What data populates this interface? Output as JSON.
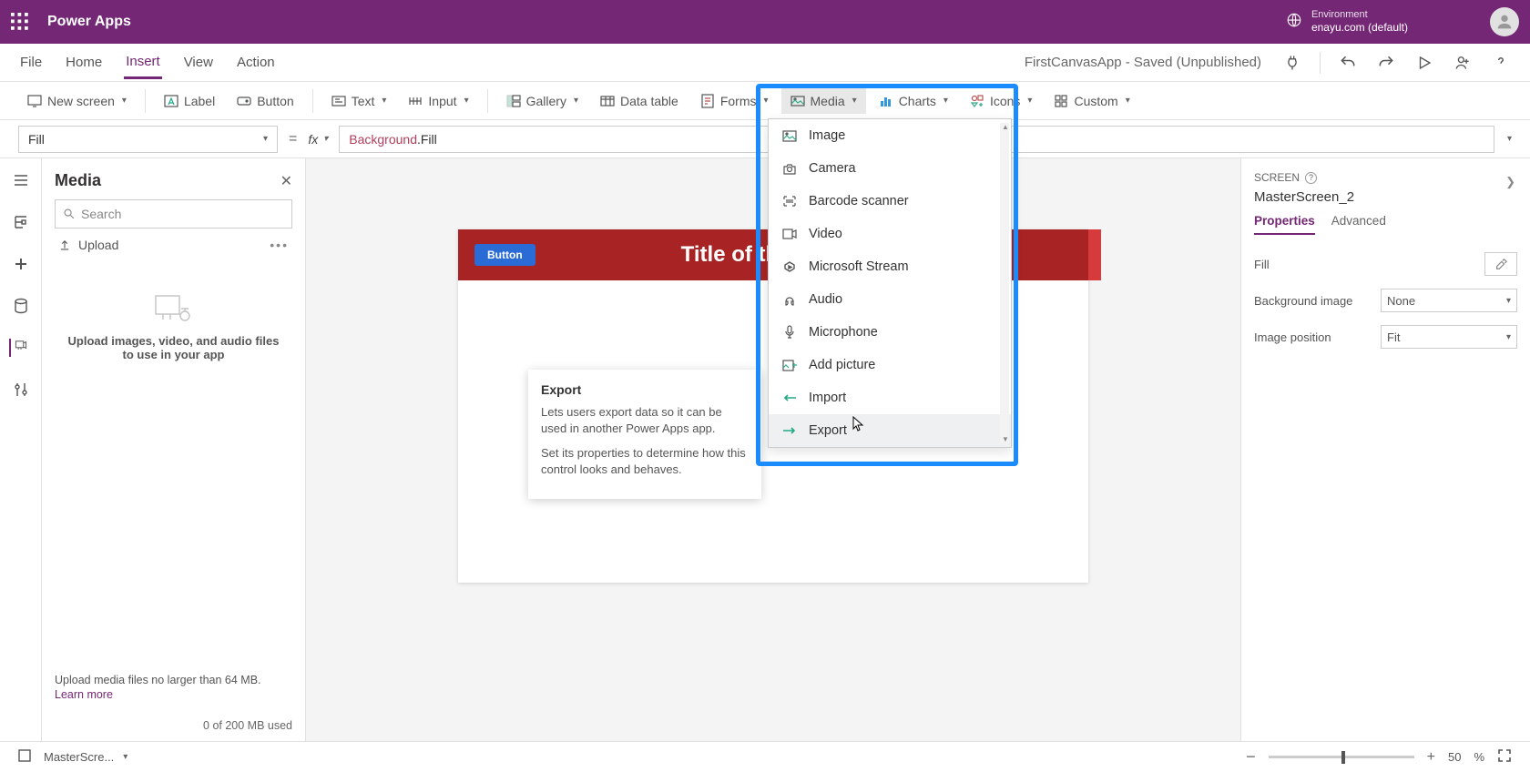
{
  "header": {
    "app_name": "Power Apps",
    "env_label": "Environment",
    "env_name": "enayu.com (default)"
  },
  "menu": {
    "tabs": [
      "File",
      "Home",
      "Insert",
      "View",
      "Action"
    ],
    "active": "Insert",
    "file_status": "FirstCanvasApp - Saved (Unpublished)"
  },
  "ribbon": {
    "new_screen": "New screen",
    "label": "Label",
    "button": "Button",
    "text": "Text",
    "input": "Input",
    "gallery": "Gallery",
    "data_table": "Data table",
    "forms": "Forms",
    "media": "Media",
    "charts": "Charts",
    "icons": "Icons",
    "custom": "Custom"
  },
  "formula": {
    "prop": "Fill",
    "fx": "fx",
    "kw": "Background",
    "rest": ".Fill"
  },
  "media_panel": {
    "title": "Media",
    "search_placeholder": "Search",
    "upload": "Upload",
    "empty_text": "Upload images, video, and audio files to use in your app",
    "foot_text": "Upload media files no larger than 64 MB.",
    "learn_more": "Learn more",
    "used": "0 of 200 MB used"
  },
  "canvas": {
    "button_label": "Button",
    "title": "Title of the Sc"
  },
  "tooltip": {
    "title": "Export",
    "p1": "Lets users export data so it can be used in another Power Apps app.",
    "p2": "Set its properties to determine how this control looks and behaves."
  },
  "dropdown": {
    "items": [
      "Image",
      "Camera",
      "Barcode scanner",
      "Video",
      "Microsoft Stream",
      "Audio",
      "Microphone",
      "Add picture",
      "Import",
      "Export"
    ],
    "hovered": "Export"
  },
  "right": {
    "screen_label": "SCREEN",
    "screen_name": "MasterScreen_2",
    "tabs": [
      "Properties",
      "Advanced"
    ],
    "active_tab": "Properties",
    "fill_label": "Fill",
    "bg_label": "Background image",
    "bg_value": "None",
    "imgpos_label": "Image position",
    "imgpos_value": "Fit"
  },
  "footer": {
    "screen_sel": "MasterScre...",
    "zoom": "50",
    "pct": "%"
  }
}
